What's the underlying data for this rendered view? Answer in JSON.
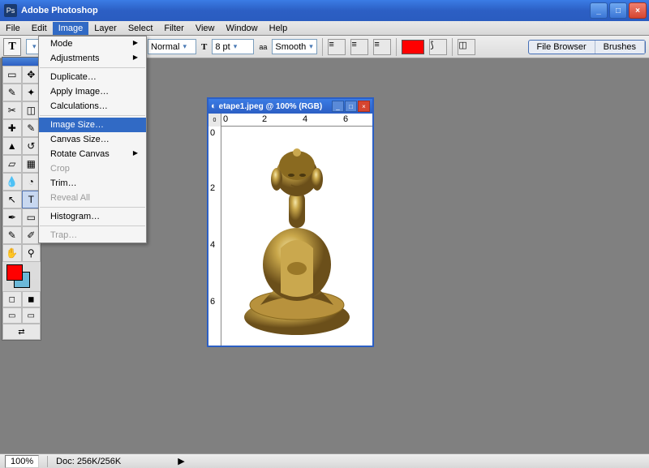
{
  "app": {
    "title": "Adobe Photoshop"
  },
  "menubar": [
    "File",
    "Edit",
    "Image",
    "Layer",
    "Select",
    "Filter",
    "View",
    "Window",
    "Help"
  ],
  "active_menu_index": 2,
  "image_menu": {
    "items": [
      {
        "label": "Mode",
        "sub": true
      },
      {
        "label": "Adjustments",
        "sub": true
      },
      {
        "type": "sep"
      },
      {
        "label": "Duplicate…"
      },
      {
        "label": "Apply Image…"
      },
      {
        "label": "Calculations…"
      },
      {
        "type": "sep"
      },
      {
        "label": "Image Size…",
        "highlight": true
      },
      {
        "label": "Canvas Size…"
      },
      {
        "label": "Rotate Canvas",
        "sub": true
      },
      {
        "label": "Crop",
        "disabled": true
      },
      {
        "label": "Trim…"
      },
      {
        "label": "Reveal All",
        "disabled": true
      },
      {
        "type": "sep"
      },
      {
        "label": "Histogram…"
      },
      {
        "type": "sep"
      },
      {
        "label": "Trap…",
        "disabled": true
      }
    ]
  },
  "options": {
    "tool_letter": "T",
    "mode": "Normal",
    "size_icon": "T",
    "size_value": "8 pt",
    "aa_label": "aa",
    "smoothing": "Smooth",
    "swatch_color": "#ff0000"
  },
  "right_tabs": [
    "File Browser",
    "Brushes"
  ],
  "document": {
    "title": "etape1.jpeg @ 100% (RGB)",
    "ruler_h": [
      "0",
      "2",
      "4",
      "6"
    ],
    "ruler_v": [
      "0",
      "2",
      "4",
      "6"
    ]
  },
  "status": {
    "zoom": "100%",
    "doc": "Doc: 256K/256K"
  },
  "colors": {
    "fg": "#ff0000",
    "bg": "#6bb8d8"
  },
  "icons": {
    "min": "_",
    "max": "□",
    "close": "×",
    "tool_glyphs": [
      "▭",
      "⤱",
      "◻",
      "✎",
      "⊕",
      "⌒",
      "⟋",
      "◉",
      "◢",
      "⌫",
      "⟋",
      "T",
      "✎",
      "⬚",
      "◯",
      "✋",
      "⚲"
    ]
  }
}
